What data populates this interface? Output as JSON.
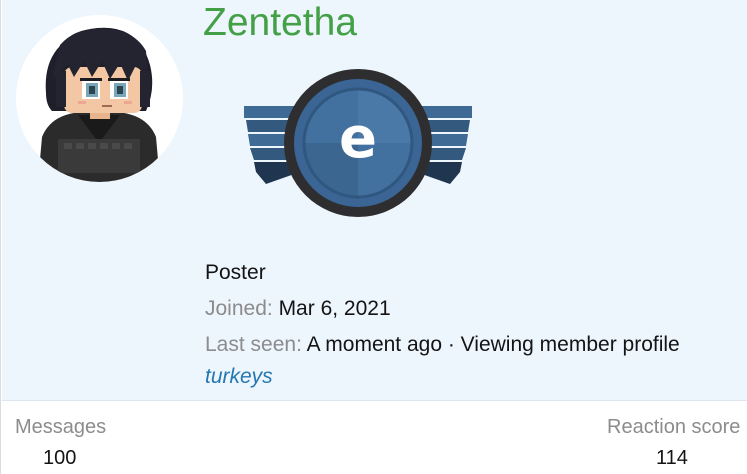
{
  "profile": {
    "username": "Zentetha",
    "badge_letter": "e",
    "user_title": "Poster",
    "joined_label": "Joined:",
    "joined_value": "Mar 6, 2021",
    "last_seen_label": "Last seen:",
    "last_seen_value": "A moment ago · Viewing member profile",
    "location": "turkeys"
  },
  "stats": {
    "messages_label": "Messages",
    "messages_value": "100",
    "reaction_label": "Reaction score",
    "reaction_value": "114"
  },
  "colors": {
    "username": "#43a046",
    "link": "#2577b1",
    "header_bg": "#edf5fd",
    "muted_text": "#8c8c8c",
    "badge_blue": "#3d6a98"
  }
}
